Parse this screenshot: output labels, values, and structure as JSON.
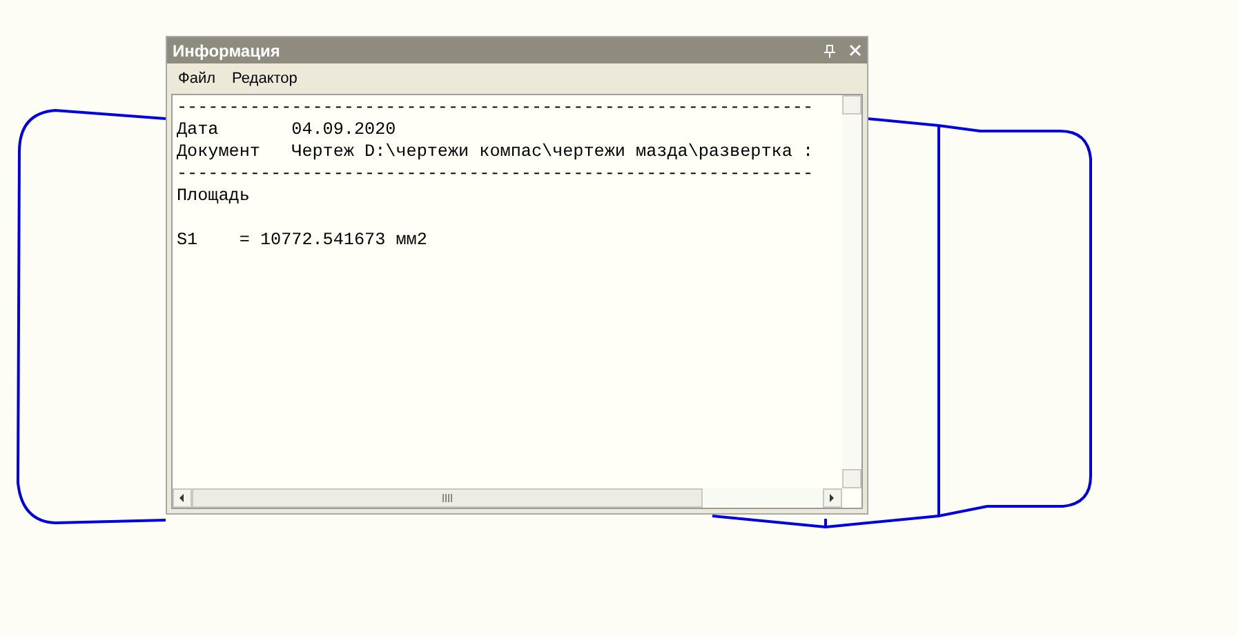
{
  "window": {
    "title": "Информация",
    "active": false
  },
  "menu": [
    {
      "label": "Файл"
    },
    {
      "label": "Редактор"
    }
  ],
  "paragraphs": [
    {
      "lines": [
        "-------------------------------------------------------------",
        "Дата       04.09.2020",
        "Документ   Чертеж D:\\чертежи компас\\чертежи мазда\\развертка :",
        "-------------------------------------------------------------",
        "Площадь"
      ]
    },
    {
      "lines": [
        "S1    = 10772.541673 мм2"
      ]
    }
  ]
}
